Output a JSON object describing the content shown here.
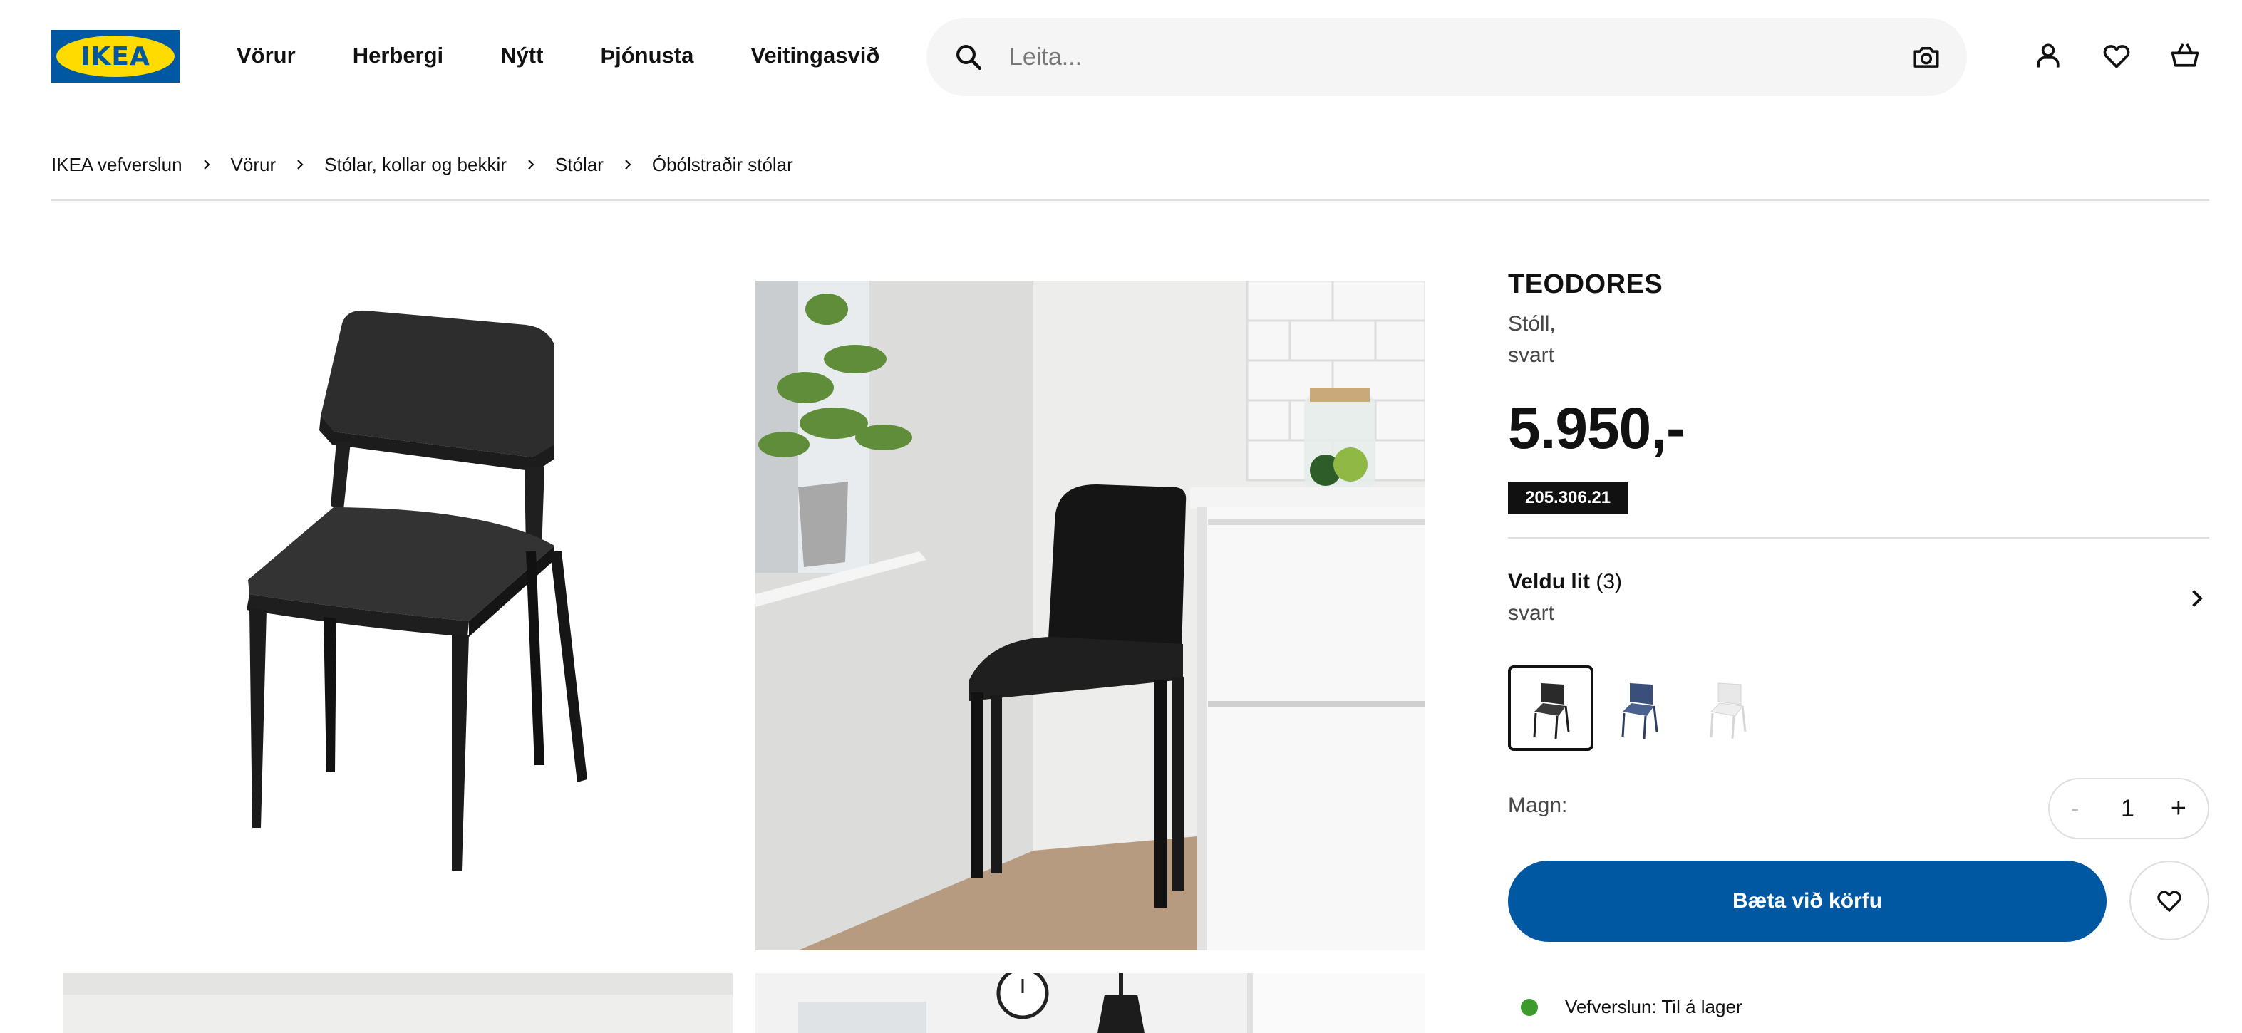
{
  "header": {
    "logo_text": "IKEA",
    "nav": [
      "Vörur",
      "Herbergi",
      "Nýtt",
      "Þjónusta",
      "Veitingasvið"
    ],
    "search_placeholder": "Leita...",
    "icons": [
      "search-icon",
      "camera-icon",
      "account-icon",
      "heart-icon",
      "cart-icon"
    ]
  },
  "breadcrumb": [
    "IKEA vefverslun",
    "Vörur",
    "Stólar, kollar og bekkir",
    "Stólar",
    "Óbólstraðir stólar"
  ],
  "product": {
    "name": "TEODORES",
    "desc_line1": "Stóll,",
    "desc_line2": "svart",
    "price": "5.950,-",
    "article_number": "205.306.21"
  },
  "colors": {
    "title": "Veldu lit",
    "count": "(3)",
    "selected": "svart",
    "swatches": [
      {
        "name": "svart",
        "hex": "#2a2a2a"
      },
      {
        "name": "blátt",
        "hex": "#3a4f7a"
      },
      {
        "name": "hvítt",
        "hex": "#e6e6e6"
      }
    ]
  },
  "quantity": {
    "label": "Magn:",
    "minus": "-",
    "value": "1",
    "plus": "+"
  },
  "cta": {
    "add_to_cart": "Bæta við körfu"
  },
  "stock": {
    "text": "Vefverslun: Til á lager",
    "color": "#3c9b2b"
  },
  "theme": {
    "brand_blue": "#0058a3",
    "brand_yellow": "#ffdb00"
  }
}
